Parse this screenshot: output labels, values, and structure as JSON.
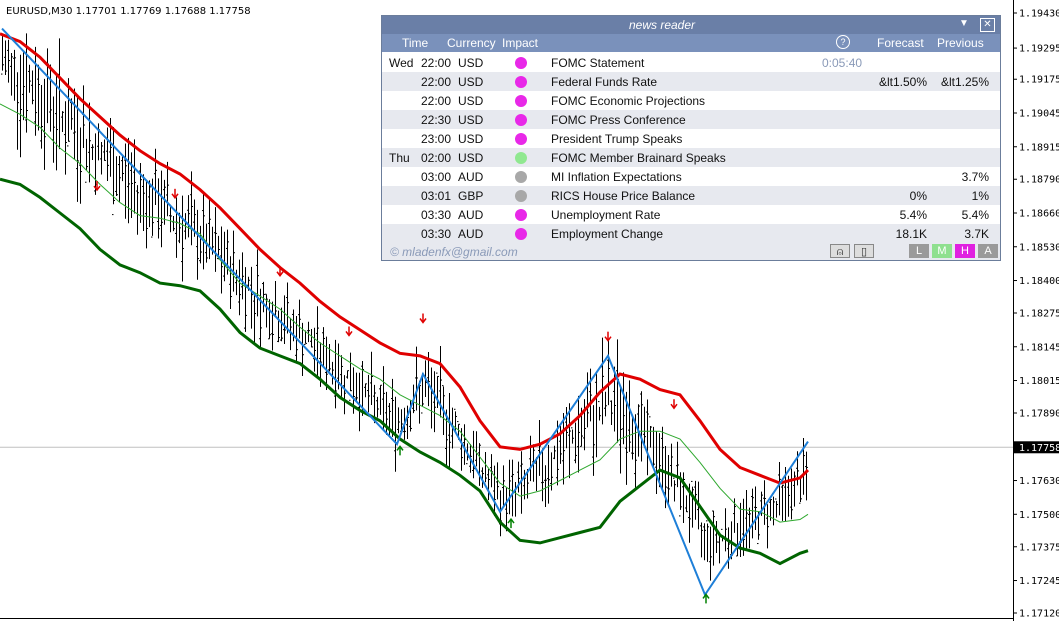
{
  "chart": {
    "symbol_header": "EURUSD,M30  1.17701 1.17769 1.17688 1.17758",
    "current_price": "1.17758",
    "current_price_value": 1.17758,
    "price_ticks": [
      "1.19430",
      "1.19295",
      "1.19175",
      "1.19045",
      "1.18915",
      "1.18790",
      "1.18660",
      "1.18530",
      "1.18400",
      "1.18275",
      "1.18145",
      "1.18015",
      "1.17890",
      "1.17630",
      "1.17500",
      "1.17375",
      "1.17245",
      "1.17120"
    ],
    "colors": {
      "upper_band": "#e00000",
      "lower_band": "#006400",
      "middle_band": "#2ea82e",
      "zigzag": "#1e7fd8",
      "bars": "#000000",
      "price_tag_bg": "#000000",
      "price_line": "#c0c0c0"
    },
    "upper_band": [
      [
        0,
        1.1935
      ],
      [
        20,
        1.1932
      ],
      [
        40,
        1.1926
      ],
      [
        60,
        1.1918
      ],
      [
        80,
        1.191
      ],
      [
        100,
        1.1903
      ],
      [
        120,
        1.1896
      ],
      [
        140,
        1.189
      ],
      [
        160,
        1.1885
      ],
      [
        180,
        1.1881
      ],
      [
        200,
        1.1875
      ],
      [
        220,
        1.1868
      ],
      [
        240,
        1.186
      ],
      [
        260,
        1.1852
      ],
      [
        280,
        1.1845
      ],
      [
        300,
        1.1839
      ],
      [
        320,
        1.1832
      ],
      [
        340,
        1.1826
      ],
      [
        360,
        1.1821
      ],
      [
        380,
        1.1816
      ],
      [
        400,
        1.1812
      ],
      [
        420,
        1.1811
      ],
      [
        440,
        1.1808
      ],
      [
        460,
        1.1799
      ],
      [
        480,
        1.1786
      ],
      [
        500,
        1.1776
      ],
      [
        520,
        1.1775
      ],
      [
        540,
        1.1777
      ],
      [
        560,
        1.1781
      ],
      [
        580,
        1.1788
      ],
      [
        600,
        1.1797
      ],
      [
        620,
        1.1804
      ],
      [
        640,
        1.1802
      ],
      [
        660,
        1.1798
      ],
      [
        680,
        1.1796
      ],
      [
        700,
        1.1786
      ],
      [
        720,
        1.1775
      ],
      [
        740,
        1.1768
      ],
      [
        760,
        1.1765
      ],
      [
        780,
        1.1762
      ],
      [
        800,
        1.1764
      ],
      [
        808,
        1.1767
      ]
    ],
    "lower_band": [
      [
        0,
        1.1879
      ],
      [
        20,
        1.1877
      ],
      [
        40,
        1.1872
      ],
      [
        60,
        1.1866
      ],
      [
        80,
        1.186
      ],
      [
        100,
        1.1852
      ],
      [
        120,
        1.1846
      ],
      [
        140,
        1.1843
      ],
      [
        160,
        1.1839
      ],
      [
        180,
        1.1838
      ],
      [
        200,
        1.1836
      ],
      [
        220,
        1.1829
      ],
      [
        240,
        1.182
      ],
      [
        260,
        1.1814
      ],
      [
        280,
        1.1811
      ],
      [
        300,
        1.1808
      ],
      [
        320,
        1.1802
      ],
      [
        340,
        1.1795
      ],
      [
        360,
        1.179
      ],
      [
        380,
        1.1786
      ],
      [
        400,
        1.1779
      ],
      [
        420,
        1.1774
      ],
      [
        440,
        1.177
      ],
      [
        460,
        1.1765
      ],
      [
        480,
        1.1759
      ],
      [
        500,
        1.1747
      ],
      [
        520,
        1.174
      ],
      [
        540,
        1.1739
      ],
      [
        560,
        1.1741
      ],
      [
        580,
        1.1743
      ],
      [
        600,
        1.1745
      ],
      [
        620,
        1.1755
      ],
      [
        640,
        1.1761
      ],
      [
        660,
        1.1767
      ],
      [
        680,
        1.1764
      ],
      [
        700,
        1.1753
      ],
      [
        720,
        1.1742
      ],
      [
        740,
        1.1737
      ],
      [
        760,
        1.1735
      ],
      [
        780,
        1.1731
      ],
      [
        800,
        1.1735
      ],
      [
        808,
        1.1736
      ]
    ],
    "middle_band": [
      [
        0,
        1.1908
      ],
      [
        20,
        1.1904
      ],
      [
        40,
        1.1899
      ],
      [
        60,
        1.1891
      ],
      [
        80,
        1.1885
      ],
      [
        100,
        1.1877
      ],
      [
        120,
        1.187
      ],
      [
        140,
        1.1865
      ],
      [
        160,
        1.1864
      ],
      [
        180,
        1.1862
      ],
      [
        200,
        1.1858
      ],
      [
        220,
        1.1848
      ],
      [
        240,
        1.1839
      ],
      [
        260,
        1.1834
      ],
      [
        280,
        1.1829
      ],
      [
        300,
        1.1822
      ],
      [
        320,
        1.1816
      ],
      [
        340,
        1.1811
      ],
      [
        360,
        1.1806
      ],
      [
        380,
        1.1802
      ],
      [
        400,
        1.1796
      ],
      [
        420,
        1.1792
      ],
      [
        440,
        1.1788
      ],
      [
        460,
        1.1782
      ],
      [
        480,
        1.1772
      ],
      [
        500,
        1.1762
      ],
      [
        520,
        1.1757
      ],
      [
        540,
        1.1759
      ],
      [
        560,
        1.1763
      ],
      [
        580,
        1.1767
      ],
      [
        600,
        1.1771
      ],
      [
        620,
        1.1779
      ],
      [
        640,
        1.1782
      ],
      [
        660,
        1.1782
      ],
      [
        680,
        1.1779
      ],
      [
        700,
        1.177
      ],
      [
        720,
        1.176
      ],
      [
        740,
        1.1752
      ],
      [
        760,
        1.1751
      ],
      [
        780,
        1.1747
      ],
      [
        800,
        1.1748
      ],
      [
        808,
        1.175
      ]
    ],
    "zigzag": [
      [
        2,
        1.1937
      ],
      [
        397,
        1.1777
      ],
      [
        423,
        1.1804
      ],
      [
        500,
        1.1751
      ],
      [
        608,
        1.1811
      ],
      [
        705,
        1.1719
      ],
      [
        808,
        1.1778
      ]
    ],
    "bar_range": [
      2,
      808
    ],
    "arrows_down": [
      [
        97,
        1.1876
      ],
      [
        175,
        1.1873
      ],
      [
        280,
        1.1843
      ],
      [
        349,
        1.182
      ],
      [
        423,
        1.1825
      ],
      [
        608,
        1.1818
      ],
      [
        674,
        1.1792
      ]
    ],
    "arrows_up": [
      [
        400,
        1.1775
      ],
      [
        511,
        1.1747
      ],
      [
        706,
        1.1718
      ]
    ]
  },
  "news": {
    "title": "news reader",
    "headers": {
      "time": "Time",
      "currency": "Currency",
      "impact": "Impact",
      "countdown_icon": "?",
      "forecast": "Forecast",
      "previous": "Previous"
    },
    "rows": [
      {
        "day": "Wed",
        "time": "22:00",
        "currency": "USD",
        "impact": "high",
        "impact_color": "#e828e8",
        "title": "FOMC Statement",
        "countdown": "0:05:40",
        "forecast": "",
        "previous": ""
      },
      {
        "day": "",
        "time": "22:00",
        "currency": "USD",
        "impact": "high",
        "impact_color": "#e828e8",
        "title": "Federal Funds Rate",
        "countdown": "",
        "forecast": "&lt1.50%",
        "previous": "&lt1.25%"
      },
      {
        "day": "",
        "time": "22:00",
        "currency": "USD",
        "impact": "high",
        "impact_color": "#e828e8",
        "title": "FOMC Economic Projections",
        "countdown": "",
        "forecast": "",
        "previous": ""
      },
      {
        "day": "",
        "time": "22:30",
        "currency": "USD",
        "impact": "high",
        "impact_color": "#e828e8",
        "title": "FOMC Press Conference",
        "countdown": "",
        "forecast": "",
        "previous": ""
      },
      {
        "day": "",
        "time": "23:00",
        "currency": "USD",
        "impact": "high",
        "impact_color": "#e828e8",
        "title": "President Trump Speaks",
        "countdown": "",
        "forecast": "",
        "previous": ""
      },
      {
        "day": "Thu",
        "time": "02:00",
        "currency": "USD",
        "impact": "medium",
        "impact_color": "#90e890",
        "title": "FOMC Member Brainard Speaks",
        "countdown": "",
        "forecast": "",
        "previous": ""
      },
      {
        "day": "",
        "time": "03:00",
        "currency": "AUD",
        "impact": "low",
        "impact_color": "#a8a8a8",
        "title": "MI Inflation Expectations",
        "countdown": "",
        "forecast": "",
        "previous": "3.7%"
      },
      {
        "day": "",
        "time": "03:01",
        "currency": "GBP",
        "impact": "low",
        "impact_color": "#a8a8a8",
        "title": "RICS House Price Balance",
        "countdown": "",
        "forecast": "0%",
        "previous": "1%"
      },
      {
        "day": "",
        "time": "03:30",
        "currency": "AUD",
        "impact": "high",
        "impact_color": "#e828e8",
        "title": "Unemployment Rate",
        "countdown": "",
        "forecast": "5.4%",
        "previous": "5.4%"
      },
      {
        "day": "",
        "time": "03:30",
        "currency": "AUD",
        "impact": "high",
        "impact_color": "#e828e8",
        "title": "Employment Change",
        "countdown": "",
        "forecast": "18.1K",
        "previous": "3.7K"
      }
    ],
    "footer": {
      "email": "© mladenfx@gmail.com",
      "bell_icon": "bell-icon",
      "clip_icon": "clipboard-icon",
      "filter_low": "L",
      "filter_medium": "M",
      "filter_high": "H",
      "filter_all": "A"
    }
  }
}
